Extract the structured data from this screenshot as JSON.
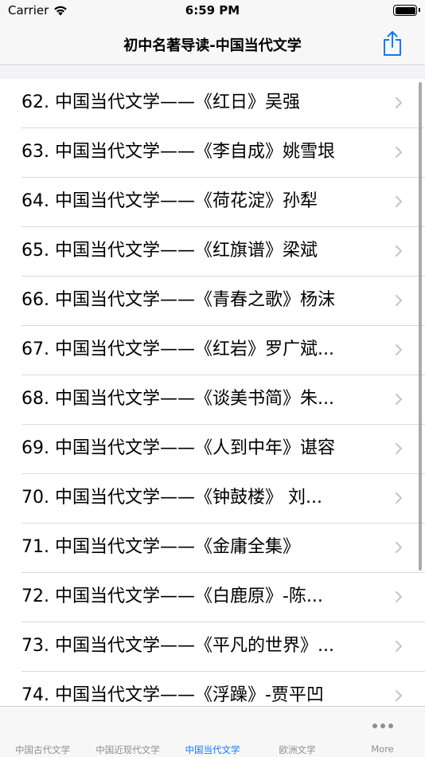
{
  "status_bar": {
    "carrier": "Carrier",
    "time": "6:59 PM"
  },
  "nav": {
    "title": "初中名著导读-中国当代文学",
    "share_icon": "share-icon"
  },
  "list": {
    "items": [
      {
        "label": "62. 中国当代文学——《红日》吴强"
      },
      {
        "label": "63. 中国当代文学——《李自成》姚雪垠"
      },
      {
        "label": "64. 中国当代文学——《荷花淀》孙犁"
      },
      {
        "label": "65. 中国当代文学——《红旗谱》梁斌"
      },
      {
        "label": "66. 中国当代文学——《青春之歌》杨沫"
      },
      {
        "label": "67. 中国当代文学——《红岩》罗广斌..."
      },
      {
        "label": "68. 中国当代文学——《谈美书简》朱..."
      },
      {
        "label": "69. 中国当代文学——《人到中年》谌容"
      },
      {
        "label": "70. 中国当代文学——《钟鼓楼》 刘..."
      },
      {
        "label": "71. 中国当代文学——《金庸全集》"
      },
      {
        "label": "72. 中国当代文学——《白鹿原》-陈..."
      },
      {
        "label": "73. 中国当代文学——《平凡的世界》..."
      },
      {
        "label": "74. 中国当代文学——《浮躁》-贾平凹"
      }
    ]
  },
  "tabs": [
    {
      "label": "中国古代文学"
    },
    {
      "label": "中国近现代文学"
    },
    {
      "label": "中国当代文学"
    },
    {
      "label": "欧洲文学"
    },
    {
      "label": "More"
    }
  ],
  "colors": {
    "accent": "#0a7aff",
    "inactive": "#8e8e93",
    "chevron": "#c4c4c7"
  }
}
